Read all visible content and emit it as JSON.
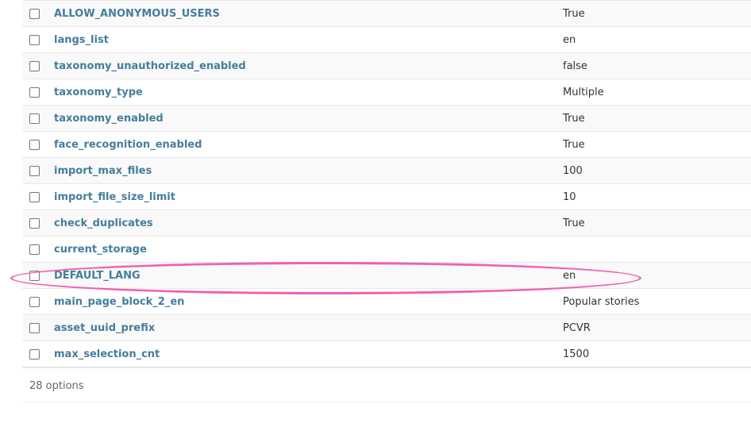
{
  "rows": [
    {
      "name": "ALLOW_ANONYMOUS_USERS",
      "value": "True"
    },
    {
      "name": "langs_list",
      "value": "en"
    },
    {
      "name": "taxonomy_unauthorized_enabled",
      "value": "false"
    },
    {
      "name": "taxonomy_type",
      "value": "Multiple"
    },
    {
      "name": "taxonomy_enabled",
      "value": "True"
    },
    {
      "name": "face_recognition_enabled",
      "value": "True"
    },
    {
      "name": "import_max_files",
      "value": "100"
    },
    {
      "name": "import_file_size_limit",
      "value": "10"
    },
    {
      "name": "check_duplicates",
      "value": "True"
    },
    {
      "name": "current_storage",
      "value": ""
    },
    {
      "name": "DEFAULT_LANG",
      "value": "en"
    },
    {
      "name": "main_page_block_2_en",
      "value": "Popular stories"
    },
    {
      "name": "asset_uuid_prefix",
      "value": "PCVR"
    },
    {
      "name": "max_selection_cnt",
      "value": "1500"
    }
  ],
  "footer": {
    "count_label": "28 options"
  },
  "colors": {
    "link": "#447e9b",
    "highlight": "#f060b0"
  }
}
